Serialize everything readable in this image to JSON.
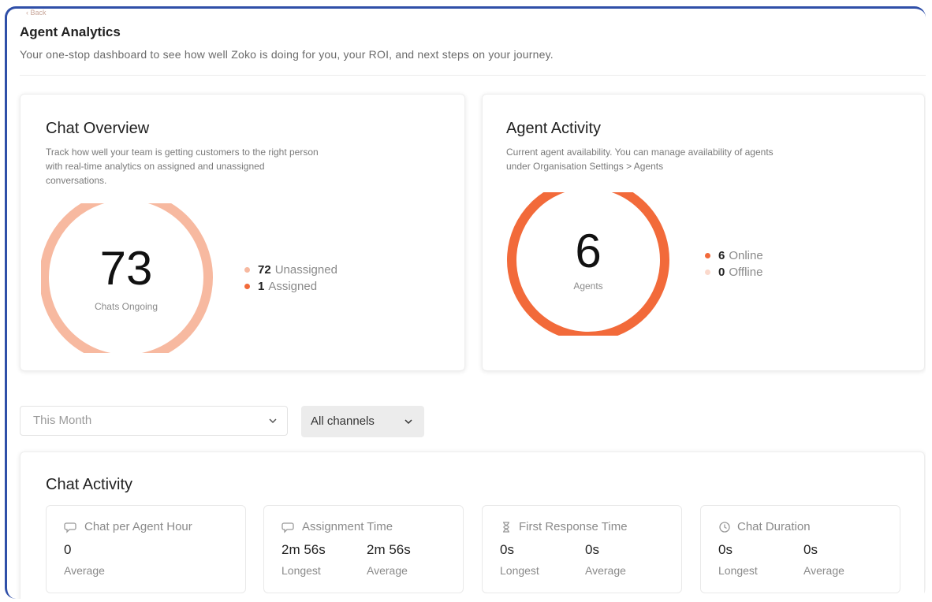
{
  "header": {
    "crumb": "‹ Back",
    "title": "Agent Analytics",
    "subtitle": "Your one-stop dashboard to see how well Zoko is doing for you, your ROI, and next steps on your journey."
  },
  "chat_overview": {
    "title": "Chat Overview",
    "desc_line1": "Track how well your team is getting customers to the right person",
    "desc_line2": "with real-time analytics on assigned and unassigned",
    "desc_line3": "conversations.",
    "total": "73",
    "total_label": "Chats Ongoing",
    "unassigned_value": "72",
    "unassigned_label": "Unassigned",
    "assigned_value": "1",
    "assigned_label": "Assigned",
    "unassigned_count": 72,
    "assigned_count": 1,
    "colors": {
      "unassigned": "#f7b9a0",
      "assigned": "#f26a3a"
    }
  },
  "agent_activity": {
    "title": "Agent Activity",
    "desc_line1": "Current agent availability. You can manage availability of agents",
    "desc_line2": "under Organisation Settings > Agents",
    "total": "6",
    "total_label": "Agents",
    "online_value": "6",
    "online_label": "Online",
    "offline_value": "0",
    "offline_label": "Offline",
    "online_count": 6,
    "offline_count": 0,
    "colors": {
      "online": "#f26a3a",
      "offline": "#fbd9cc"
    }
  },
  "filters": {
    "period": "This Month",
    "channels": "All channels"
  },
  "chat_activity": {
    "title": "Chat Activity",
    "metrics": [
      {
        "icon": "chat-icon",
        "label": "Chat per Agent Hour",
        "v1": "0",
        "l1": "Average"
      },
      {
        "icon": "chat-icon",
        "label": "Assignment Time",
        "v1": "2m 56s",
        "l1": "Longest",
        "v2": "2m 56s",
        "l2": "Average"
      },
      {
        "icon": "hourglass-icon",
        "label": "First Response Time",
        "v1": "0s",
        "l1": "Longest",
        "v2": "0s",
        "l2": "Average"
      },
      {
        "icon": "clock-icon",
        "label": "Chat Duration",
        "v1": "0s",
        "l1": "Longest",
        "v2": "0s",
        "l2": "Average"
      }
    ]
  },
  "accent": "#f26a3a"
}
